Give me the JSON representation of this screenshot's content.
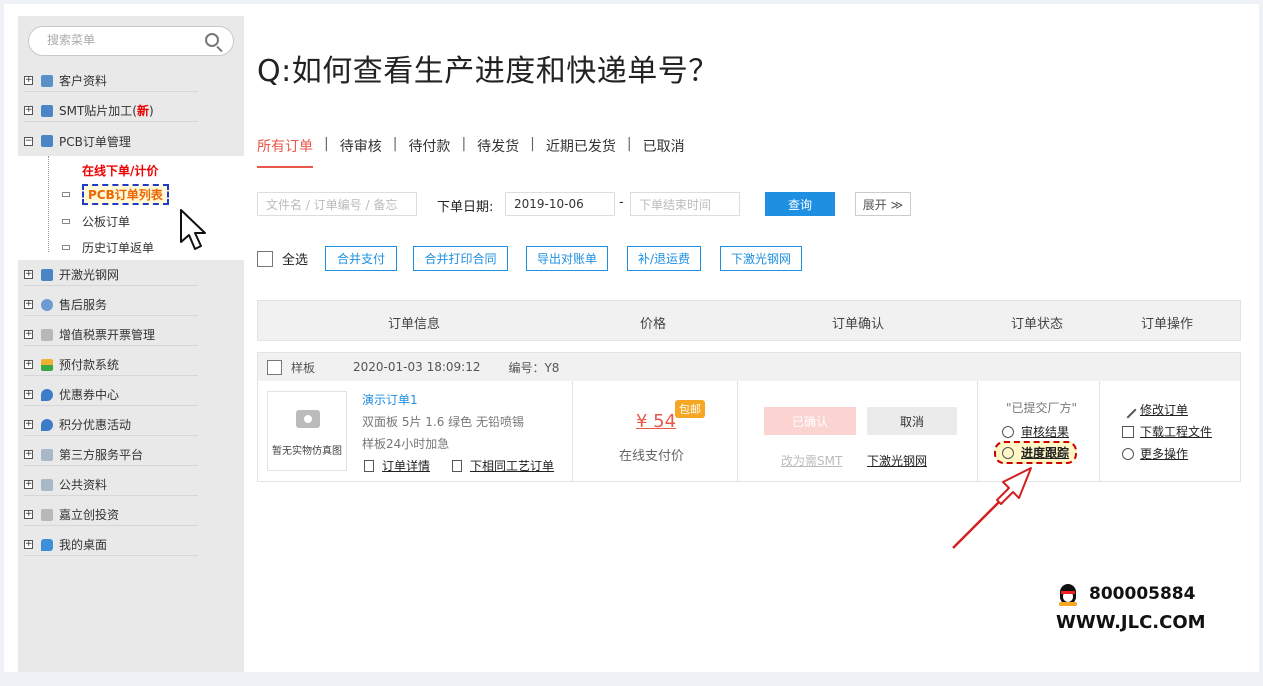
{
  "sidebar": {
    "search_placeholder": "搜索菜单",
    "items": [
      {
        "label": "客户资料",
        "toggle": "+"
      },
      {
        "label": "SMT贴片加工(",
        "new": "新",
        "tail": ")",
        "toggle": "+"
      },
      {
        "label": "PCB订单管理",
        "toggle": "−"
      },
      {
        "label": "开激光钢网",
        "toggle": "+"
      },
      {
        "label": "售后服务",
        "toggle": "+"
      },
      {
        "label": "增值税票开票管理",
        "toggle": "+"
      },
      {
        "label": "预付款系统",
        "toggle": "+"
      },
      {
        "label": "优惠券中心",
        "toggle": "+"
      },
      {
        "label": "积分优惠活动",
        "toggle": "+"
      },
      {
        "label": "第三方服务平台",
        "toggle": "+"
      },
      {
        "label": "公共资料",
        "toggle": "+"
      },
      {
        "label": "嘉立创投资",
        "toggle": "+"
      },
      {
        "label": "我的桌面",
        "toggle": "+"
      }
    ],
    "sub_items": [
      "在线下单/计价",
      "PCB订单列表",
      "公板订单",
      "历史订单返单"
    ]
  },
  "main": {
    "title": "Q:如何查看生产进度和快递单号？",
    "tabs": [
      "所有订单",
      "待审核",
      "待付款",
      "待发货",
      "近期已发货",
      "已取消"
    ],
    "tab_sep": "|",
    "filter": {
      "keyword_placeholder": "文件名 / 订单编号 / 备忘",
      "date_label": "下单日期:",
      "date_start": "2019-10-06",
      "date_dash": "-",
      "date_end_placeholder": "下单结束时间",
      "query": "查询",
      "expand": "展开 ≫"
    },
    "actions": {
      "select_all": "全选",
      "buttons": [
        "合并支付",
        "合并打印合同",
        "导出对账单",
        "补/退运费",
        "下激光钢网"
      ]
    },
    "table_headers": [
      "订单信息",
      "价格",
      "订单确认",
      "订单状态",
      "订单操作"
    ],
    "order": {
      "type": "样板",
      "datetime": "2020-01-03 18:09:12",
      "number": "编号：Y8",
      "thumb_text": "暂无实物仿真图",
      "name": "演示订单1",
      "spec": "双面板   5片   1.6   绿色   无铅喷锡",
      "spec2": "样板24小时加急",
      "detail_link": "订单详情",
      "same_process_link": "下相同工艺订单",
      "price": "¥ 54",
      "free_tag": "包邮",
      "pay_type": "在线支付价",
      "confirmed": "已确认",
      "cancel": "取消",
      "change_smt": "改为需SMT",
      "stencil": "下激光钢网",
      "status": "\"已提交厂方\"",
      "review_result": "审核结果",
      "progress_track": "进度跟踪",
      "modify": "修改订单",
      "download": "下载工程文件",
      "more": "更多操作"
    }
  },
  "contact": {
    "qq": "800005884",
    "site": "WWW.JLC.COM"
  },
  "colors": {
    "accent_blue": "#1e8fe1",
    "tab_active": "#e8584a",
    "new_red": "#e00000",
    "arrow_red": "#d42020"
  }
}
